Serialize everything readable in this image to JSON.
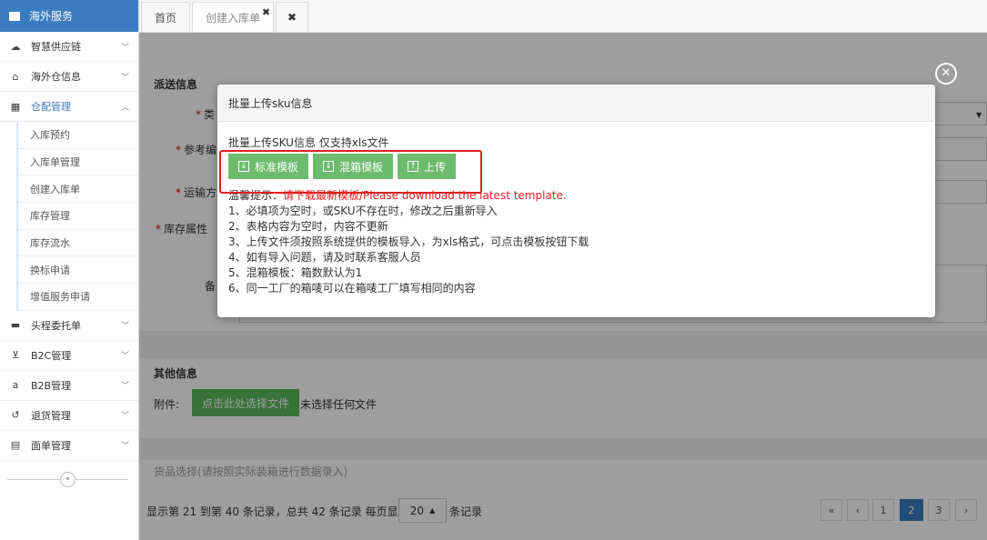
{
  "sidebar": {
    "brand": "海外服务",
    "items": [
      {
        "label": "智慧供应链",
        "icon": "cloud-icon",
        "glyph": "☁"
      },
      {
        "label": "海外仓信息",
        "icon": "home-icon",
        "glyph": "⌂"
      },
      {
        "label": "仓配管理",
        "icon": "grid-icon",
        "glyph": "▦"
      }
    ],
    "sub_items": [
      "入库预约",
      "入库单管理",
      "创建入库单",
      "库存管理",
      "库存流水",
      "换标申请",
      "增值服务申请"
    ],
    "items_after": [
      {
        "label": "头程委托单",
        "icon": "briefcase-icon",
        "glyph": "▬"
      },
      {
        "label": "B2C管理",
        "icon": "cart-icon",
        "glyph": "⊻"
      },
      {
        "label": "B2B管理",
        "icon": "amazon-icon",
        "glyph": "a"
      },
      {
        "label": "退货管理",
        "icon": "undo-icon",
        "glyph": "↺"
      },
      {
        "label": "面单管理",
        "icon": "document-icon",
        "glyph": "▤"
      }
    ],
    "collapse_glyph": "«"
  },
  "tabs": {
    "home": "首页",
    "create": "创建入库单",
    "create_close": "✖",
    "close_all": "✖"
  },
  "form": {
    "section_title": "派送信息",
    "labels": {
      "type": "类",
      "ref": "参考编",
      "transport": "运输方",
      "stock_attr": "库存属性",
      "remark": "备"
    },
    "required_mark": "*"
  },
  "other": {
    "section_title": "其他信息",
    "attach_label": "附件:",
    "choose_button": "点击此处选择文件",
    "no_file": "未选择任何文件"
  },
  "goods_tip": "货品选择(请按照实际装箱进行数据录入)",
  "pager": {
    "summary": "显示第 21 到第 40 条记录，总共 42 条记录 每页显示",
    "page_size": "20",
    "page_size_arrow": "▲",
    "suffix": "条记录",
    "first": "«",
    "prev": "‹",
    "pages": [
      "1",
      "2",
      "3"
    ],
    "next": "›"
  },
  "modal": {
    "title": "批量上传sku信息",
    "upload_title": "批量上传SKU信息 仅支持xls文件",
    "buttons": [
      {
        "label": "标准模板",
        "icon": "download-icon",
        "glyph": "↓"
      },
      {
        "label": "混箱模板",
        "icon": "download-icon",
        "glyph": "↓"
      },
      {
        "label": "上传",
        "icon": "upload-icon",
        "glyph": "↑"
      }
    ],
    "tip_prefix": "温馨提示：",
    "tip_red": "请下载最新模板/Please download the latest template.",
    "tips": [
      "1、必填项为空时，或SKU不存在时，修改之后重新导入",
      "2、表格内容为空时，内容不更新",
      "3、上传文件须按照系统提供的模板导入，为xls格式，可点击模板按钮下载",
      "4、如有导入问题，请及时联系客服人员",
      "5、混箱模板：箱数默认为1",
      "6、同一工厂的箱唛可以在箱唛工厂填写相同的内容"
    ],
    "close_glyph": "✕"
  },
  "colors": {
    "brand": "#3b7bbf",
    "green": "#6dbb6d",
    "highlight": "#e02020"
  }
}
